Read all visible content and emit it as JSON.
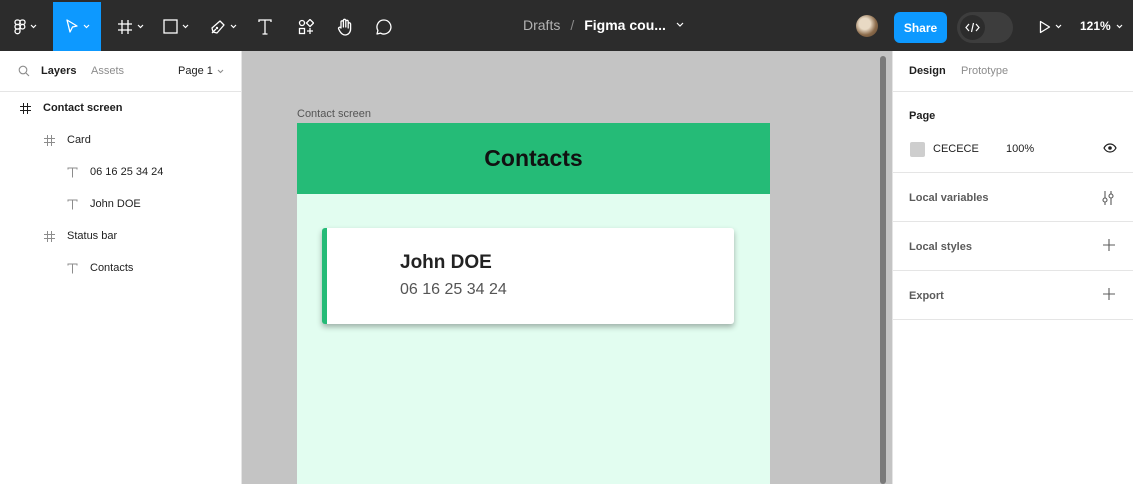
{
  "toolbar": {
    "breadcrumb_drafts": "Drafts",
    "breadcrumb_file": "Figma cou...",
    "share_label": "Share",
    "zoom": "121%",
    "icons": [
      "figma-menu-icon",
      "move-tool-icon",
      "frame-tool-icon",
      "shape-tool-icon",
      "pen-tool-icon",
      "text-tool-icon",
      "resources-icon",
      "hand-tool-icon",
      "comment-icon",
      "dev-mode-icon",
      "present-icon"
    ],
    "active_tool": "move-tool",
    "accent": "#0d99ff"
  },
  "left_panel": {
    "tabs": [
      "Layers",
      "Assets"
    ],
    "page_selector": "Page 1",
    "layers": [
      {
        "name": "Contact screen",
        "type": "frame",
        "depth": 0
      },
      {
        "name": "Card",
        "type": "frame",
        "depth": 1
      },
      {
        "name": "06 16 25 34 24",
        "type": "text",
        "depth": 2
      },
      {
        "name": "John DOE",
        "type": "text",
        "depth": 2
      },
      {
        "name": "Status bar",
        "type": "frame",
        "depth": 1
      },
      {
        "name": "Contacts",
        "type": "text",
        "depth": 2
      }
    ]
  },
  "canvas": {
    "frame_label": "Contact screen",
    "header_title": "Contacts",
    "card_name": "John DOE",
    "card_phone": "06 16 25 34 24",
    "header_color": "#25bb77",
    "frame_bg": "#e2fdf0",
    "canvas_bg": "#c4c4c4"
  },
  "right_panel": {
    "tabs": [
      "Design",
      "Prototype"
    ],
    "page_section_title": "Page",
    "page_color_hex": "CECECE",
    "page_color_opacity": "100%",
    "local_variables": "Local variables",
    "local_styles": "Local styles",
    "export": "Export"
  }
}
